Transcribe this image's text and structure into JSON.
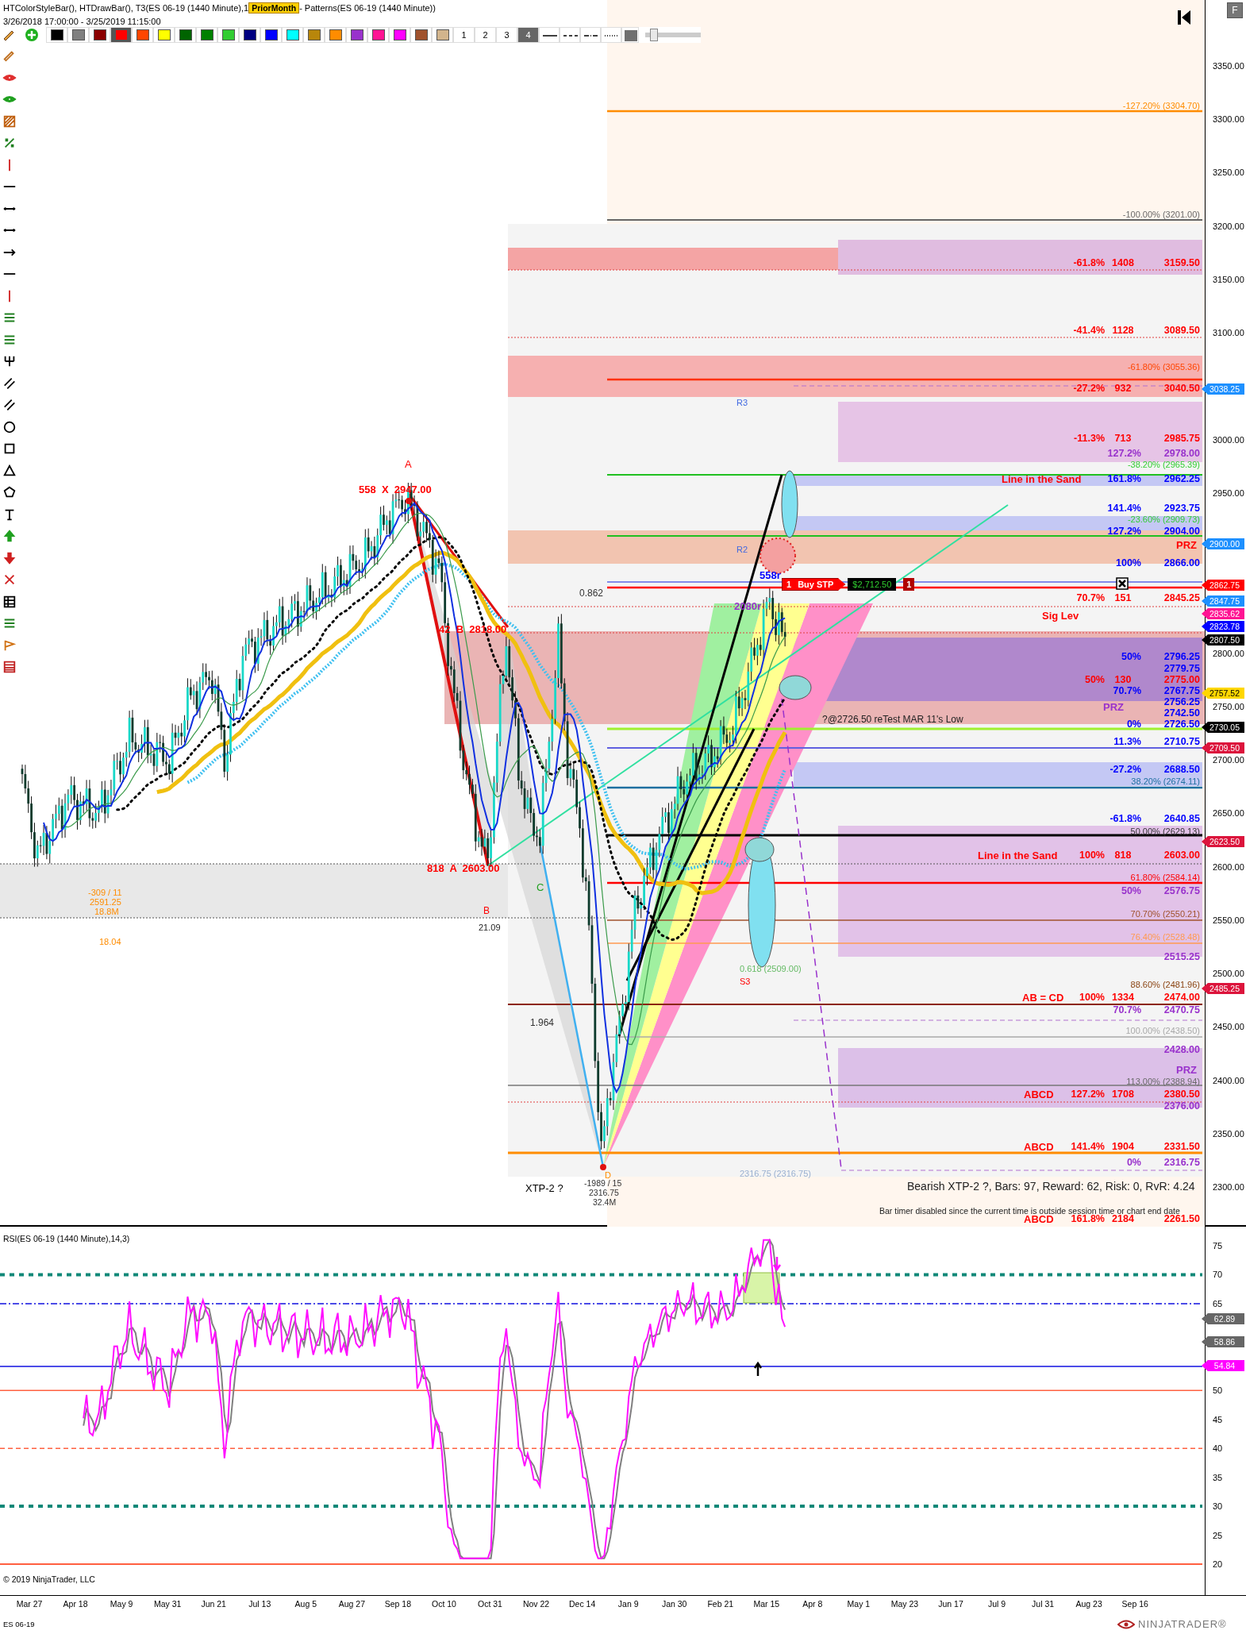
{
  "header": {
    "indicators_before": "HTColorStyleBar(), HTDrawBar(), T3(ES 06-19 (1440 Minute),1",
    "badge": "PriorMonth",
    "indicators_after": "- Patterns(ES 06-19 (1440 Minute))",
    "range": "3/26/2018 17:00:00 - 3/25/2019 11:15:00"
  },
  "toolbar": {
    "colors": [
      {
        "color": "#000000",
        "selected": false
      },
      {
        "color": "#808080",
        "selected": false
      },
      {
        "color": "#8b0000",
        "selected": false
      },
      {
        "color": "#ff0000",
        "selected": true
      },
      {
        "color": "#ff4500",
        "selected": false
      },
      {
        "color": "#ffff00",
        "selected": false
      },
      {
        "color": "#006400",
        "selected": false
      },
      {
        "color": "#008000",
        "selected": false
      },
      {
        "color": "#32cd32",
        "selected": false
      },
      {
        "color": "#000080",
        "selected": false
      },
      {
        "color": "#0000ff",
        "selected": false
      },
      {
        "color": "#00ffff",
        "selected": false
      },
      {
        "color": "#b8860b",
        "selected": false
      },
      {
        "color": "#ff8c00",
        "selected": false
      },
      {
        "color": "#9932cc",
        "selected": false
      },
      {
        "color": "#ff1493",
        "selected": false
      },
      {
        "color": "#ff00ff",
        "selected": false
      },
      {
        "color": "#a0522d",
        "selected": false
      },
      {
        "color": "#d2b48c",
        "selected": false
      }
    ],
    "widths": [
      {
        "label": "1",
        "selected": false
      },
      {
        "label": "2",
        "selected": false
      },
      {
        "label": "3",
        "selected": false
      },
      {
        "label": "4",
        "selected": true
      }
    ],
    "line_styles": [
      {
        "kind": "solid"
      },
      {
        "kind": "dash"
      },
      {
        "kind": "dashdot"
      },
      {
        "kind": "dot"
      }
    ],
    "opacity_slider": {
      "level": 0.1
    }
  },
  "drawing_tools": [
    {
      "kind": "pencil"
    },
    {
      "kind": "eye",
      "color": "#e03030"
    },
    {
      "kind": "eye",
      "color": "#20a020"
    },
    {
      "kind": "hatch"
    },
    {
      "kind": "percent"
    },
    {
      "kind": "v-line"
    },
    {
      "kind": "h-line"
    },
    {
      "kind": "dots-line"
    },
    {
      "kind": "dots-line"
    },
    {
      "kind": "arrow-line"
    },
    {
      "kind": "h-line"
    },
    {
      "kind": "v-line"
    },
    {
      "kind": "h-lines"
    },
    {
      "kind": "h-lines"
    },
    {
      "kind": "fork"
    },
    {
      "kind": "parallel"
    },
    {
      "kind": "parallel"
    },
    {
      "kind": "circle"
    },
    {
      "kind": "square"
    },
    {
      "kind": "triangle"
    },
    {
      "kind": "polygon"
    },
    {
      "kind": "text"
    },
    {
      "kind": "arrow-up"
    },
    {
      "kind": "arrow-down"
    },
    {
      "kind": "x-mark"
    },
    {
      "kind": "grid"
    },
    {
      "kind": "h-lines"
    },
    {
      "kind": "flag"
    },
    {
      "kind": "table"
    }
  ],
  "chart_buttons": {
    "go_start": true,
    "label_button": "F"
  },
  "order": {
    "qty": "1",
    "action": "Buy STP",
    "price": "$2,712.50",
    "count": "1"
  },
  "price_axis": {
    "ticks": [
      "3350.00",
      "3300.00",
      "3250.00",
      "3200.00",
      "3150.00",
      "3100.00",
      "3000.00",
      "2950.00",
      "2800.00",
      "2750.00",
      "2700.00",
      "2650.00",
      "2600.00",
      "2550.00",
      "2500.00",
      "2450.00",
      "2400.00",
      "2350.00",
      "2300.00"
    ],
    "tags": [
      {
        "text": "3038.25",
        "color": "#1e90ff"
      },
      {
        "text": "2900.00",
        "color": "#1e90ff"
      },
      {
        "text": "2862.75",
        "color": "#ff0000"
      },
      {
        "text": "2847.75",
        "color": "#1e90ff"
      },
      {
        "text": "2835.62",
        "color": "#ff1493"
      },
      {
        "text": "2823.78",
        "color": "#0000ff"
      },
      {
        "text": "2807.50",
        "color": "#000000"
      },
      {
        "text": "2757.52",
        "color": "#ffd700"
      },
      {
        "text": "2730.05",
        "color": "#000000"
      },
      {
        "text": "2709.50",
        "color": "#dc143c"
      },
      {
        "text": "2623.50",
        "color": "#dc143c"
      },
      {
        "text": "2485.25",
        "color": "#dc143c"
      }
    ]
  },
  "level_labels": [
    {
      "pct": "-61.8%",
      "count": "1408",
      "price": "3159.50",
      "color": "#ff0000"
    },
    {
      "pct": "-41.4%",
      "count": "1128",
      "price": "3089.50",
      "color": "#ff0000"
    },
    {
      "pct": "-27.2%",
      "count": "932",
      "price": "3040.50",
      "color": "#ff0000"
    },
    {
      "pct": "-11.3%",
      "count": "713",
      "price": "2985.75",
      "color": "#ff0000"
    },
    {
      "pct": "127.2%",
      "price": "2978.00",
      "color": "#9932cc"
    },
    {
      "pct": "161.8%",
      "price": "2962.25",
      "color": "#0000ff"
    },
    {
      "pct": "141.4%",
      "price": "2923.75",
      "color": "#0000ff"
    },
    {
      "pct": "127.2%",
      "price": "2904.00",
      "color": "#0000ff"
    },
    {
      "pct": "100%",
      "price": "2866.00",
      "color": "#0000ff"
    },
    {
      "pct": "70.7%",
      "count": "151",
      "price": "2845.25",
      "color": "#ff0000"
    },
    {
      "pct": "50%",
      "price": "2796.25",
      "color": "#0000ff"
    },
    {
      "price": "2779.75",
      "color": "#0000ff"
    },
    {
      "pct": "50%",
      "count": "130",
      "price": "2775.00",
      "color": "#ff0000"
    },
    {
      "pct": "70.7%",
      "price": "2767.75",
      "color": "#0000ff"
    },
    {
      "price": "2756.25",
      "color": "#0000ff"
    },
    {
      "price": "2742.50",
      "color": "#0000ff"
    },
    {
      "pct": "0%",
      "price": "2726.50",
      "color": "#0000ff"
    },
    {
      "pct": "11.3%",
      "price": "2710.75",
      "color": "#0000ff"
    },
    {
      "pct": "-27.2%",
      "price": "2688.50",
      "color": "#0000ff"
    },
    {
      "pct": "-61.8%",
      "price": "2640.85",
      "color": "#0000ff"
    },
    {
      "pct": "100%",
      "count": "818",
      "price": "2603.00",
      "color": "#ff0000"
    },
    {
      "pct": "50%",
      "price": "2576.75",
      "color": "#9932cc"
    },
    {
      "price": "2515.25",
      "color": "#9932cc"
    },
    {
      "pct": "100%",
      "count": "1334",
      "price": "2474.00",
      "color": "#ff0000"
    },
    {
      "pct": "70.7%",
      "price": "2470.75",
      "color": "#9932cc"
    },
    {
      "price": "2428.00",
      "color": "#9932cc"
    },
    {
      "pct": "127.2%",
      "count": "1708",
      "price": "2380.50",
      "color": "#ff0000"
    },
    {
      "price": "2376.00",
      "color": "#9932cc"
    },
    {
      "pct": "141.4%",
      "count": "1904",
      "price": "2331.50",
      "color": "#ff0000"
    },
    {
      "pct": "0%",
      "price": "2316.75",
      "color": "#9932cc"
    },
    {
      "pct": "161.8%",
      "count": "2184",
      "price": "2261.50",
      "color": "#ff0000"
    }
  ],
  "fib_labels": [
    {
      "text": "-127.20% (3304.70)",
      "color": "#ff8c00"
    },
    {
      "text": "-100.00% (3201.00)",
      "color": "#696969"
    },
    {
      "text": "-61.80% (3055.36)",
      "color": "#ff4500"
    },
    {
      "text": "-38.20% (2965.39)",
      "color": "#32cd32"
    },
    {
      "text": "-23.60% (2909.73)",
      "color": "#32cd32"
    },
    {
      "text": "38.20% (2674.11)",
      "color": "#1e6fa0"
    },
    {
      "text": "50.00% (2629.13)",
      "color": "#333333"
    },
    {
      "text": "61.80% (2584.14)",
      "color": "#ff0000"
    },
    {
      "text": "70.70% (2550.21)",
      "color": "#a0522d"
    },
    {
      "text": "76.40% (2528.48)",
      "color": "#ff9a50"
    },
    {
      "text": "88.60% (2481.96)",
      "color": "#8b4513"
    },
    {
      "text": "100.00% (2438.50)",
      "color": "#a9a9a9"
    },
    {
      "text": "113.00% (2388.94)",
      "color": "#696969"
    }
  ],
  "chart_notes": [
    {
      "text": "R3",
      "color": "#4169e1"
    },
    {
      "text": "A",
      "color": "#ff0000"
    },
    {
      "text": "Line in the Sand",
      "color": "#ff0000"
    },
    {
      "text": "558  X  2947.00",
      "color": "#ff0000"
    },
    {
      "text": "PRZ",
      "color": "#ff0000"
    },
    {
      "text": "R2",
      "color": "#4169e1"
    },
    {
      "text": "558r",
      "color": "#0000ff"
    },
    {
      "text": "0.862",
      "color": "#333333"
    },
    {
      "text": "2080r",
      "color": "#9932cc"
    },
    {
      "text": "Sig Lev",
      "color": "#ff0000"
    },
    {
      "text": "42  B  2818.00",
      "color": "#ff0000"
    },
    {
      "text": "PRZ",
      "color": "#9932cc"
    },
    {
      "text": "?@2726.50 reTest MAR 11's Low",
      "color": "#222222"
    },
    {
      "text": "Line in the Sand",
      "color": "#ff0000"
    },
    {
      "text": "818  A  2603.00",
      "color": "#ff0000"
    },
    {
      "text": "C",
      "color": "#20a020"
    },
    {
      "text": "-309 / 11",
      "color": "#ff8c00"
    },
    {
      "text": "2591.25",
      "color": "#ff8c00"
    },
    {
      "text": "B",
      "color": "#ff0000"
    },
    {
      "text": "18.8M",
      "color": "#ff8c00"
    },
    {
      "text": "21.09",
      "color": "#222222"
    },
    {
      "text": "18.04",
      "color": "#ff8c00"
    },
    {
      "text": "0.618 (2509.00)",
      "color": "#66bb66"
    },
    {
      "text": "S3",
      "color": "#ff0000"
    },
    {
      "text": "AB = CD",
      "color": "#ff0000"
    },
    {
      "text": "1.964",
      "color": "#333333"
    },
    {
      "text": "PRZ",
      "color": "#9932cc"
    },
    {
      "text": "ABCD",
      "color": "#ff0000"
    },
    {
      "text": "ABCD",
      "color": "#ff0000"
    },
    {
      "text": "D",
      "color": "#ff8c00"
    },
    {
      "text": "2316.75 (2316.75)",
      "color": "#9ab0d0"
    },
    {
      "text": "XTP-2 ?",
      "color": "#000000"
    },
    {
      "text": "-1989 / 15",
      "color": "#333333"
    },
    {
      "text": "Bearish XTP-2 ?, Bars: 97, Reward: 62, Risk: 0, RvR: 4.24",
      "color": "#222222"
    },
    {
      "text": "2316.75",
      "color": "#333333"
    },
    {
      "text": "32.4M",
      "color": "#333333"
    },
    {
      "text": "Bar timer disabled since the current time is outside session time or chart end date",
      "color": "#222222"
    },
    {
      "text": "ABCD",
      "color": "#ff0000"
    }
  ],
  "rsi_panel": {
    "title": "RSI(ES 06-19 (1440 Minute),14,3)",
    "ticks": [
      "75",
      "70",
      "65",
      "50",
      "45",
      "40",
      "35",
      "30",
      "25",
      "20"
    ],
    "tags": [
      {
        "text": "62.89",
        "color": "#666666"
      },
      {
        "text": "58.86",
        "color": "#666666"
      },
      {
        "text": "54.84",
        "color": "#ff00ff"
      }
    ],
    "copyright": "© 2019 NinjaTrader, LLC"
  },
  "time_axis": {
    "dates": [
      "Mar 27",
      "Apr 18",
      "May 9",
      "May 31",
      "Jun 21",
      "Jul 13",
      "Aug 5",
      "Aug 27",
      "Sep 18",
      "Oct 10",
      "Oct 31",
      "Nov 22",
      "Dec 14",
      "Jan 9",
      "Jan 30",
      "Feb 21",
      "Mar 15",
      "Apr 8",
      "May 1",
      "May 23",
      "Jun 17",
      "Jul 9",
      "Jul 31",
      "Aug 23",
      "Sep 16"
    ]
  },
  "status_bar": {
    "instrument": "ES 06-19",
    "logo": "NINJATRADER®"
  }
}
